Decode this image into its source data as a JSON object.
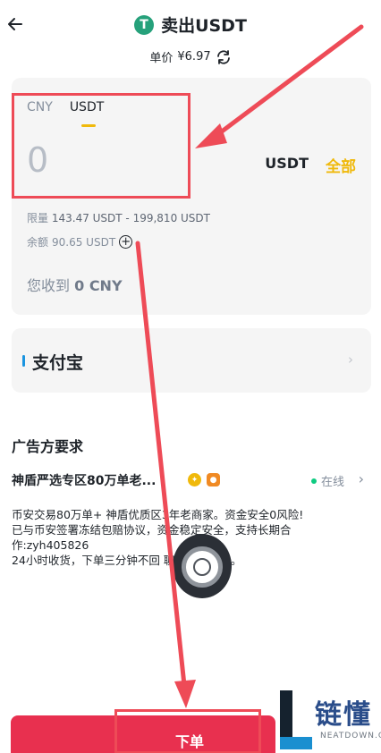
{
  "header": {
    "title": "卖出USDT",
    "tether_letter": "T",
    "price_label": "单价",
    "price_value": "¥6.97"
  },
  "amount_card": {
    "tabs": [
      {
        "label": "CNY",
        "active": false
      },
      {
        "label": "USDT",
        "active": true
      }
    ],
    "amount_value": "0",
    "unit": "USDT",
    "all_label": "全部",
    "limit_label": "限量",
    "limit_value": "143.47 USDT - 199,810 USDT",
    "balance_label": "余额",
    "balance_value": "90.65 USDT",
    "receive_label": "您收到",
    "receive_value": "0 CNY"
  },
  "payment": {
    "label": "支付宝"
  },
  "advertiser": {
    "section_title": "广告方要求",
    "name": "神盾严选专区80万单老...",
    "status": "在线",
    "description": [
      "币安交易80万单+  神盾优质区3年老商家。资金安全0风险!",
      "已与币安签署冻结包赔协议，资金稳定安全，支持长期合",
      "作:zyh405826",
      "24小时收货，下单三分钟不回      聊天窗口电话。"
    ]
  },
  "order_button": {
    "label": "下单"
  },
  "watermark": {
    "text": "链懂",
    "sub": "NEATDOWN.COM"
  },
  "colors": {
    "accent_yellow": "#f0b90b",
    "button_red": "#e8304f",
    "online_green": "#0ecb81",
    "annotation_red": "#ee4b57"
  }
}
